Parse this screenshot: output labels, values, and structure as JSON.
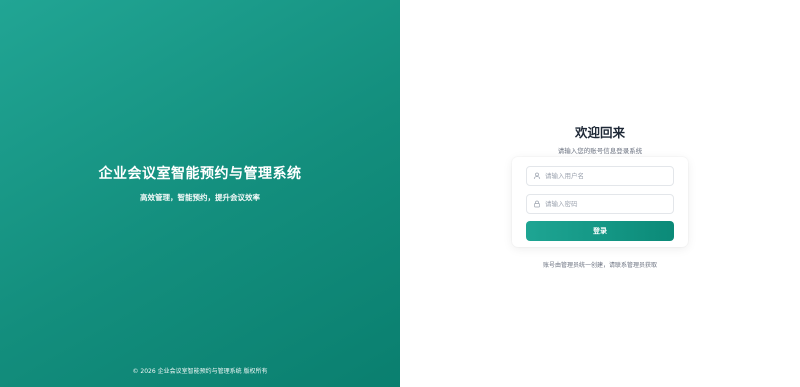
{
  "brand": {
    "title": "企业会议室智能预约与管理系统",
    "subtitle": "高效管理，智能预约，提升会议效率",
    "footer": "© 2026 企业会议室智能预约与管理系统 版权所有",
    "gradient_colors": [
      "#21a594",
      "#0a7f6f"
    ]
  },
  "login": {
    "title": "欢迎回来",
    "subtitle": "请输入您的账号信息登录系统",
    "username": {
      "placeholder": "请输入用户名",
      "value": "",
      "icon": "user-icon"
    },
    "password": {
      "placeholder": "请输入密码",
      "value": "",
      "icon": "lock-icon"
    },
    "submit_label": "登录",
    "note": "账号由管理员统一创建，请联系管理员获取",
    "accent_color": "#0f9482"
  }
}
